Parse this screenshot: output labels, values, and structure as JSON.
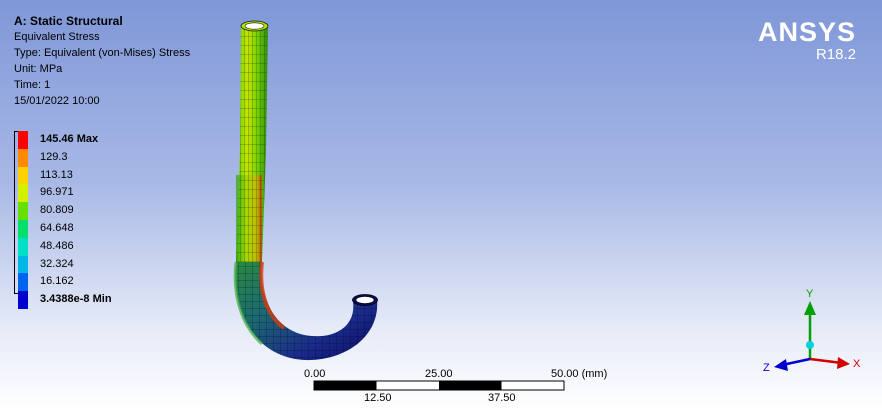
{
  "header": {
    "title": "A: Static Structural",
    "result": "Equivalent Stress",
    "type": "Type: Equivalent (von-Mises) Stress",
    "unit": "Unit: MPa",
    "time": "Time: 1",
    "date": "15/01/2022 10:00"
  },
  "legend": [
    {
      "label": "145.46 Max",
      "color": "#ff0000",
      "bold": true
    },
    {
      "label": "129.3",
      "color": "#ff8a00"
    },
    {
      "label": "113.13",
      "color": "#ffd200"
    },
    {
      "label": "96.971",
      "color": "#d4ef00"
    },
    {
      "label": "80.809",
      "color": "#66e000"
    },
    {
      "label": "64.648",
      "color": "#00e06a"
    },
    {
      "label": "48.486",
      "color": "#00e0c8"
    },
    {
      "label": "32.324",
      "color": "#00b8e6"
    },
    {
      "label": "16.162",
      "color": "#0064ee"
    },
    {
      "label": "3.4388e-8 Min",
      "color": "#0000d0",
      "bold": true
    }
  ],
  "brand": {
    "name": "ANSYS",
    "version": "R18.2"
  },
  "scale_bar": {
    "top_labels": [
      "0.00",
      "25.00",
      "50.00 (mm)"
    ],
    "bottom_labels": [
      "12.50",
      "37.50"
    ]
  },
  "triad": {
    "x": "X",
    "y": "Y",
    "z": "Z"
  }
}
